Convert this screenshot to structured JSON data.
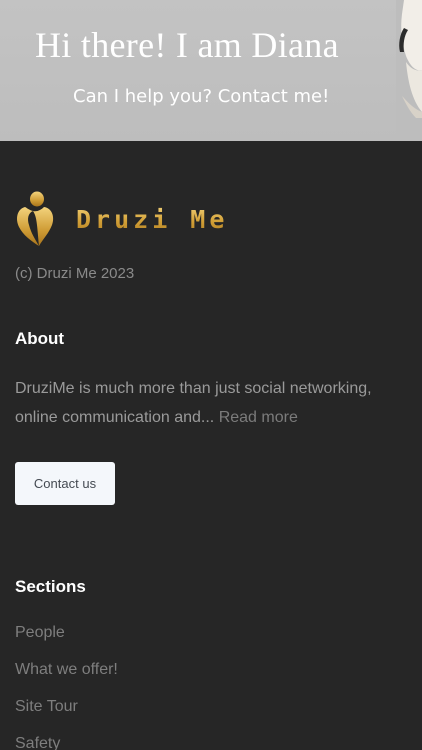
{
  "banner": {
    "title": "Hi there! I am Diana",
    "subtitle": "Can I help you? Contact me!"
  },
  "brand": {
    "name": "Druzi Me",
    "logo_icon": "heart-person-logo-icon",
    "gold": "#d3a138"
  },
  "footer": {
    "copyright": "(c) Druzi Me 2023",
    "about": {
      "heading": "About",
      "text": "DruziMe is much more than just social networking, online communication and...",
      "read_more": "Read more",
      "contact_button": "Contact us"
    },
    "sections": {
      "heading": "Sections",
      "items": [
        "People",
        "What we offer!",
        "Site Tour",
        "Safety"
      ]
    }
  },
  "colors": {
    "background": "#262626",
    "banner": "#c0c0c0",
    "heading": "#ffffff",
    "muted_text": "#8a8a8a",
    "button_bg": "#f4f7fb"
  }
}
